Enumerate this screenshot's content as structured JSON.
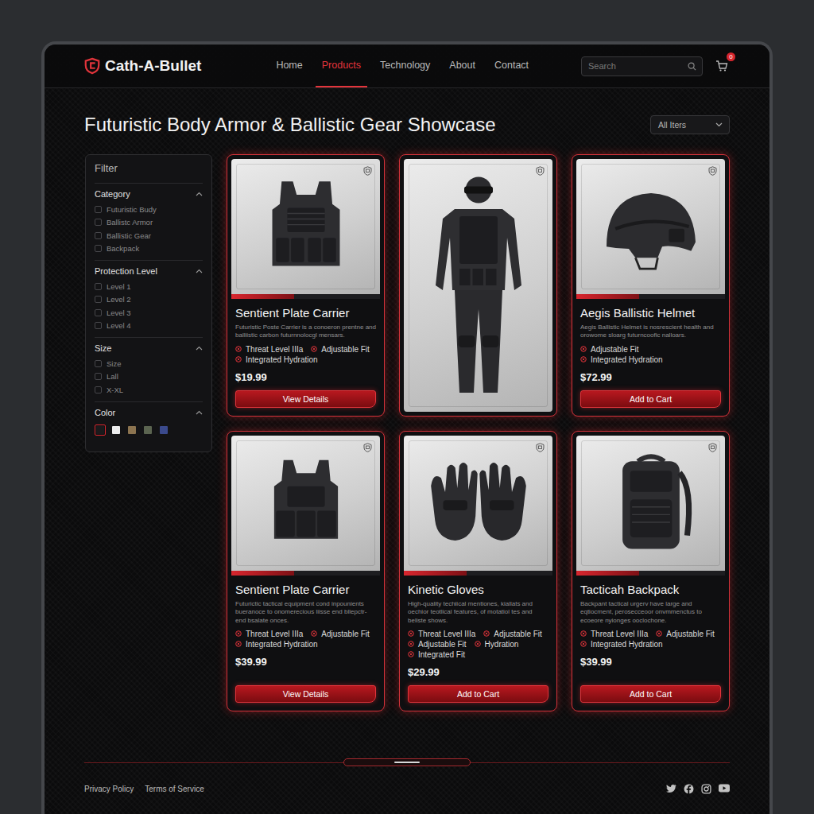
{
  "brand": {
    "name": "Cath-A-Bullet"
  },
  "nav": [
    {
      "label": "Home",
      "selected": false
    },
    {
      "label": "Products",
      "selected": true
    },
    {
      "label": "Technology",
      "selected": false
    },
    {
      "label": "About",
      "selected": false
    },
    {
      "label": "Contact",
      "selected": false
    }
  ],
  "search": {
    "placeholder": "Search"
  },
  "cart": {
    "count": "0"
  },
  "page": {
    "title": "Futuristic Body Armor & Ballistic Gear Showcase",
    "sort": "All Iters"
  },
  "filter": {
    "title": "Filter",
    "sections": [
      {
        "title": "Category",
        "expanded": true,
        "kind": "checkbox",
        "options": [
          {
            "label": "Futuristic Budy",
            "checked": false
          },
          {
            "label": "Ballistc Armor",
            "checked": false
          },
          {
            "label": "Ballistic Gear",
            "checked": false
          },
          {
            "label": "Backpack",
            "checked": false
          }
        ]
      },
      {
        "title": "Protection Level",
        "expanded": true,
        "kind": "checkbox",
        "options": [
          {
            "label": "Level 1",
            "checked": false
          },
          {
            "label": "Level 2",
            "checked": false
          },
          {
            "label": "Level 3",
            "checked": false
          },
          {
            "label": "Level 4",
            "checked": false
          }
        ]
      },
      {
        "title": "Size",
        "expanded": true,
        "kind": "checkbox",
        "options": [
          {
            "label": "Size",
            "checked": false
          },
          {
            "label": "Lall",
            "checked": false
          },
          {
            "label": "X-XL",
            "checked": false
          }
        ]
      },
      {
        "title": "Color",
        "expanded": true,
        "kind": "swatch",
        "swatches": [
          {
            "color": "#1a1a1c",
            "selected": true
          },
          {
            "color": "#ececec",
            "selected": false
          },
          {
            "color": "#8c7450",
            "selected": false
          },
          {
            "color": "#5b6450",
            "selected": false
          },
          {
            "color": "#3b4a8c",
            "selected": false
          }
        ]
      }
    ]
  },
  "products": [
    {
      "kind": "product",
      "name": "Sentient Plate Carrier",
      "description": "Futuristic Poste Carrier is a conoeron prentne and balliistic carbon futurnnolocgl mensars.",
      "features": [
        "Threat Level IIIa",
        "Adjustable Fit",
        "Integrated Hydration"
      ],
      "price": "$19.99",
      "button": "View Details"
    },
    {
      "kind": "image"
    },
    {
      "kind": "product",
      "name": "Aegis Ballistic Helmet",
      "description": "Aegis Ballistic Helmet is nosrescient health and orowome sloarg futurncoofic nalloars.",
      "features": [
        "Adjustable Fit",
        "Integrated Hydration"
      ],
      "price": "$72.99",
      "button": "Add to Cart"
    },
    {
      "kind": "product",
      "name": "Sentient Plate Carrier",
      "description": "Futurictic tactical equipment cond inpounients bueranoce to onomerecious liisse end bllepctr- end bsalate onces.",
      "features": [
        "Threat Level IIIa",
        "Adjustable Fit",
        "Integrated Hydration"
      ],
      "price": "$39.99",
      "button": "View Details"
    },
    {
      "kind": "product",
      "name": "Kinetic Gloves",
      "description": "High-quality techiical mentiones, kiallats and oechior teotlical features, of motatiol tes and beliste shows.",
      "features": [
        "Threat Level IIIa",
        "Adjustable Fit",
        "Adjustable Fit",
        "Hydration",
        "Integrated Fit"
      ],
      "price": "$29.99",
      "button": "Add to Cart"
    },
    {
      "kind": "product",
      "name": "Tacticah Backpack",
      "description": "Backpant tactical urgerv have large and eqtiocment, perosecceoor onvmmenctus to ecoeore nyionges ooclochone.",
      "features": [
        "Threat Level IIIa",
        "Adjustable Fit",
        "Integrated Hydration"
      ],
      "price": "$39.99",
      "button": "Add to Cart"
    }
  ],
  "footer": {
    "links": [
      "Privacy Policy",
      "Terms of Service"
    ]
  }
}
